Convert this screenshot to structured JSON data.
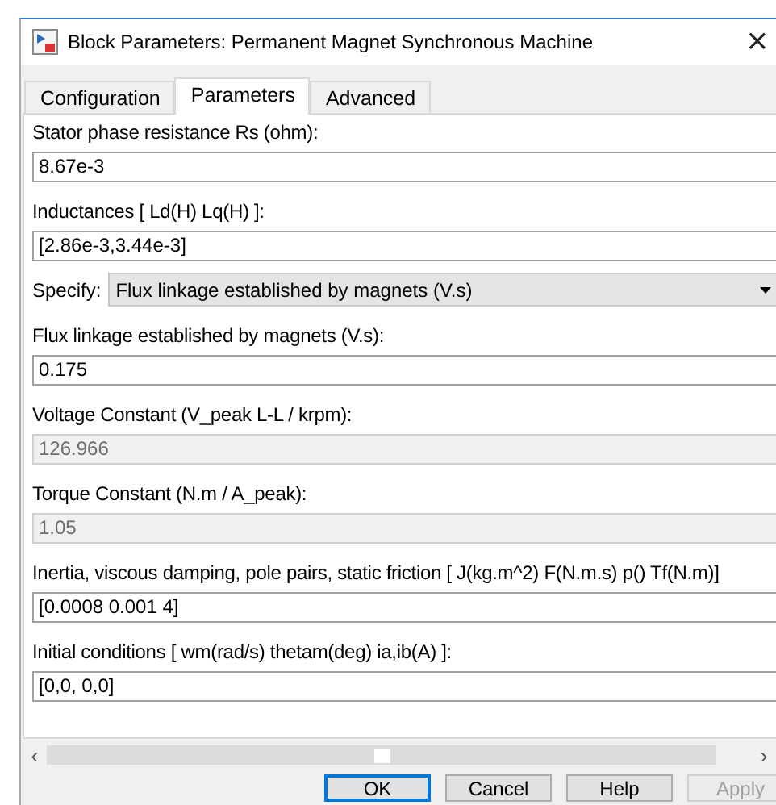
{
  "window": {
    "title": "Block Parameters: Permanent Magnet Synchronous Machine",
    "close": "×"
  },
  "tabs": [
    {
      "label": "Configuration",
      "selected": false
    },
    {
      "label": "Parameters",
      "selected": true
    },
    {
      "label": "Advanced",
      "selected": false
    }
  ],
  "params": [
    {
      "kind": "edit",
      "label": "Stator phase resistance Rs (ohm):",
      "value": "8.67e-3",
      "disabled": false
    },
    {
      "kind": "edit",
      "label": "Inductances [ Ld(H) Lq(H) ]:",
      "value": "[2.86e-3,3.44e-3]",
      "disabled": false
    },
    {
      "kind": "popup",
      "label": "Specify:",
      "value": "Flux linkage established by magnets (V.s)",
      "disabled": false
    },
    {
      "kind": "edit",
      "label": "Flux linkage established by magnets (V.s):",
      "value": "0.175",
      "disabled": false
    },
    {
      "kind": "edit",
      "label": "Voltage Constant (V_peak L-L / krpm):",
      "value": "126.966",
      "disabled": true
    },
    {
      "kind": "edit",
      "label": "Torque Constant (N.m / A_peak):",
      "value": "1.05",
      "disabled": true
    },
    {
      "kind": "edit",
      "label": "Inertia, viscous damping, pole pairs, static friction [ J(kg.m^2)  F(N.m.s)  p()  Tf(N.m)]",
      "value": "[0.0008 0.001 4]",
      "disabled": false
    },
    {
      "kind": "edit",
      "label": "Initial conditions  [ wm(rad/s)  thetam(deg)  ia,ib(A) ]:",
      "value": "[0,0, 0,0]",
      "disabled": false
    }
  ],
  "scrollbar": {
    "left": "‹",
    "right": "›"
  },
  "buttons": [
    {
      "label": "OK",
      "default": true,
      "disabled": false
    },
    {
      "label": "Cancel",
      "default": false,
      "disabled": false
    },
    {
      "label": "Help",
      "default": false,
      "disabled": false
    },
    {
      "label": "Apply",
      "default": false,
      "disabled": true
    }
  ]
}
